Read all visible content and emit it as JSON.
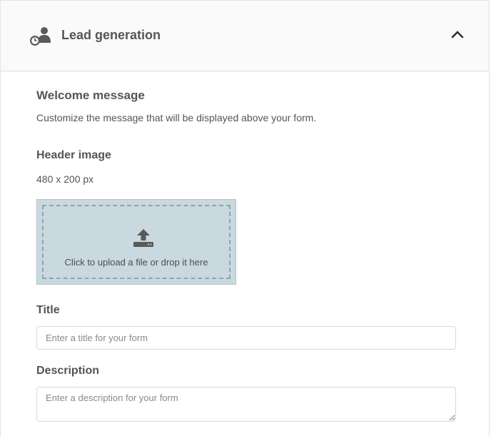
{
  "header": {
    "title": "Lead generation",
    "icon": "lead-user-icon",
    "toggle_icon": "chevron-up-icon"
  },
  "welcome": {
    "title": "Welcome message",
    "description": "Customize the message that will be displayed above your form."
  },
  "header_image": {
    "title": "Header image",
    "dimensions": "480 x 200 px",
    "upload_text": "Click to upload a file or drop it here",
    "upload_icon": "upload-icon"
  },
  "title_field": {
    "label": "Title",
    "placeholder": "Enter a title for your form",
    "value": ""
  },
  "description_field": {
    "label": "Description",
    "placeholder": "Enter a description for your form",
    "value": ""
  },
  "colors": {
    "header_bg": "#fafafa",
    "dropzone_bg": "#c9d9df",
    "dropzone_border": "#8ca6ae",
    "text": "#555555"
  }
}
